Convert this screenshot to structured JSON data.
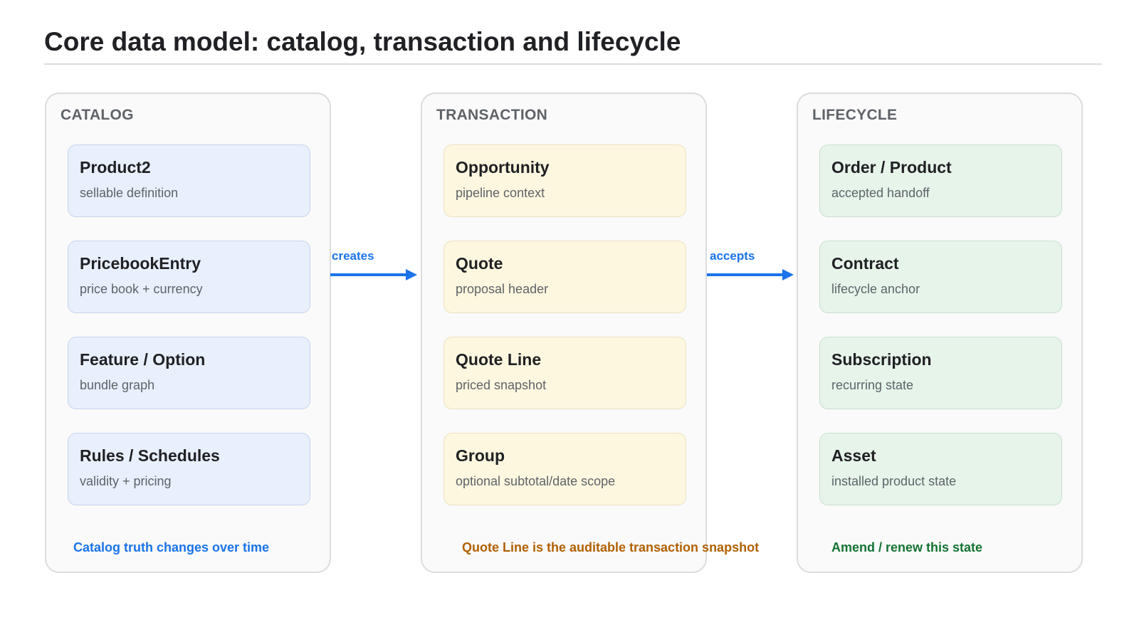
{
  "title": "Core data model: catalog, transaction and lifecycle",
  "colors": {
    "catalog_accent": "#1a73e8",
    "transaction_accent": "#b06000",
    "lifecycle_accent": "#137333",
    "arrow": "#1a73e8"
  },
  "panels": [
    {
      "header": "CATALOG",
      "cards": [
        {
          "title": "Product2",
          "subtitle": "sellable definition"
        },
        {
          "title": "PricebookEntry",
          "subtitle": "price book + currency"
        },
        {
          "title": "Feature / Option",
          "subtitle": "bundle graph"
        },
        {
          "title": "Rules / Schedules",
          "subtitle": "validity + pricing"
        }
      ],
      "footnote": "Catalog truth changes over time"
    },
    {
      "header": "TRANSACTION",
      "cards": [
        {
          "title": "Opportunity",
          "subtitle": "pipeline context"
        },
        {
          "title": "Quote",
          "subtitle": "proposal header"
        },
        {
          "title": "Quote Line",
          "subtitle": "priced snapshot"
        },
        {
          "title": "Group",
          "subtitle": "optional subtotal/date scope"
        }
      ],
      "footnote": "Quote Line is the auditable transaction snapshot"
    },
    {
      "header": "LIFECYCLE",
      "cards": [
        {
          "title": "Order / Product",
          "subtitle": "accepted handoff"
        },
        {
          "title": "Contract",
          "subtitle": "lifecycle anchor"
        },
        {
          "title": "Subscription",
          "subtitle": "recurring state"
        },
        {
          "title": "Asset",
          "subtitle": "installed product state"
        }
      ],
      "footnote": "Amend / renew this state"
    }
  ],
  "connectors": [
    {
      "label": "creates"
    },
    {
      "label": "accepts"
    }
  ]
}
